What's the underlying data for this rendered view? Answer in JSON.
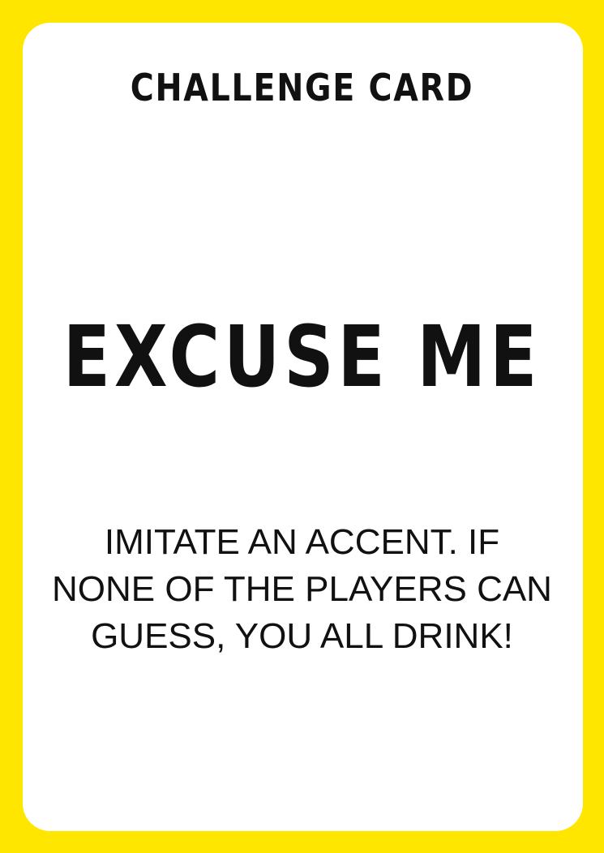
{
  "card": {
    "type_label": "CHALLENGE CARD",
    "title": "EXCUSE ME",
    "body_lines": [
      "IMITATE AN ACCENT. IF",
      "NONE OF THE PLAYERS CAN",
      "GUESS, YOU ALL DRINK!"
    ],
    "colors": {
      "border": "#ffe600",
      "face": "#ffffff",
      "text": "#111111"
    }
  }
}
